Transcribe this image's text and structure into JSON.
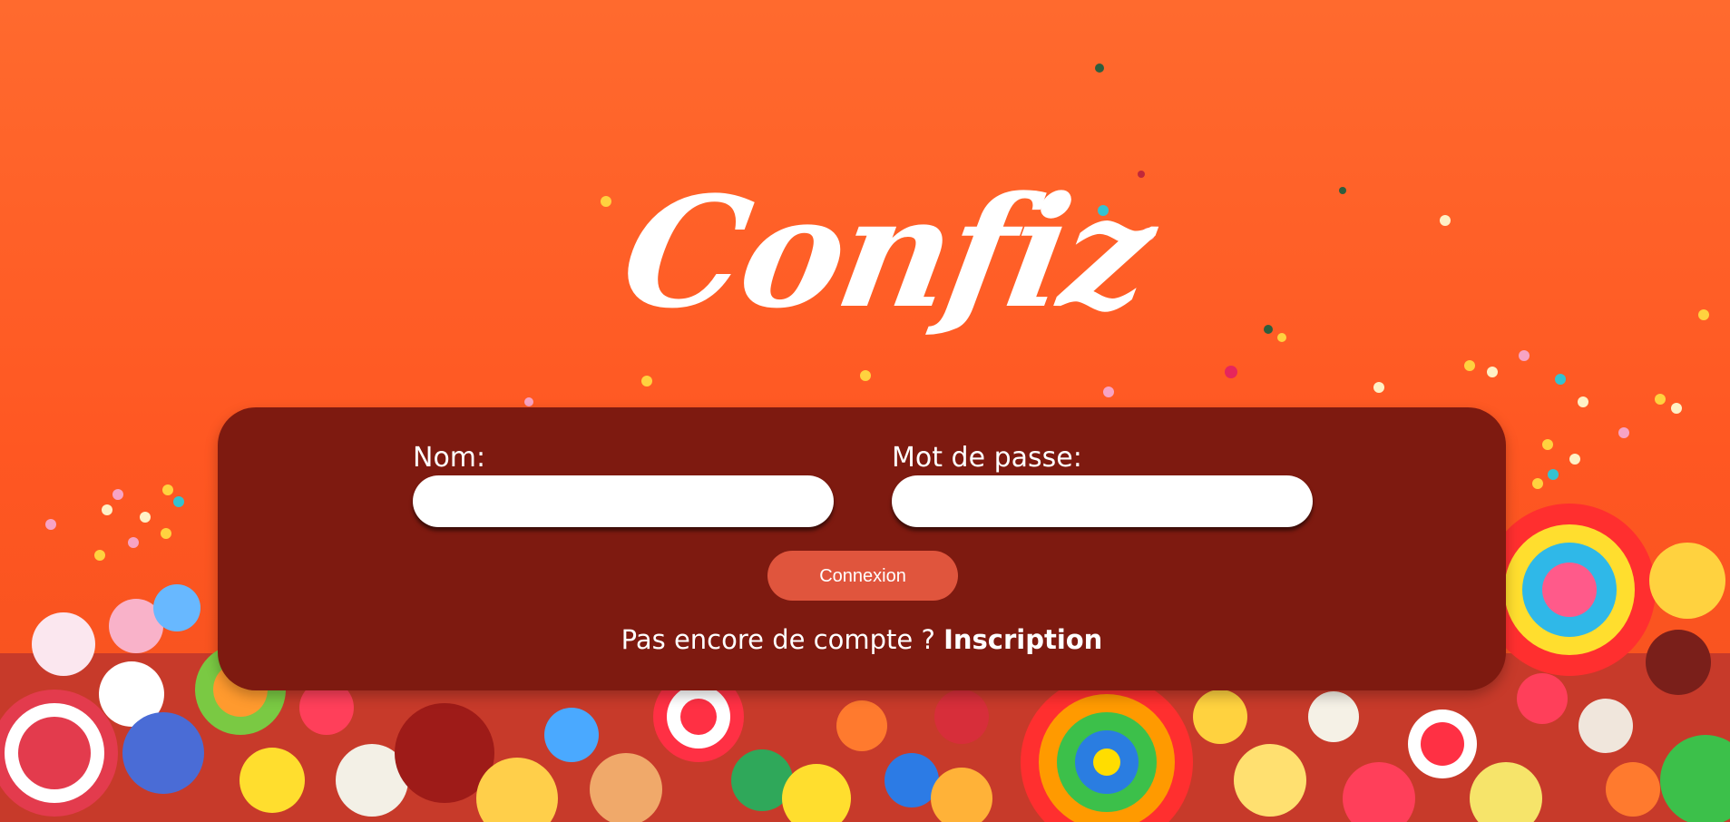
{
  "brand": {
    "logo_text": "Confiz"
  },
  "login": {
    "name_label": "Nom:",
    "name_value": "",
    "password_label": "Mot de passe:",
    "password_value": "",
    "submit_label": "Connexion",
    "no_account_text": "Pas encore de compte ?",
    "signup_label": "Inscription"
  },
  "colors": {
    "background": "#ff5722",
    "panel": "#7e1a10",
    "button": "#e0553d",
    "input": "#ffffff",
    "text": "#ffffff"
  }
}
